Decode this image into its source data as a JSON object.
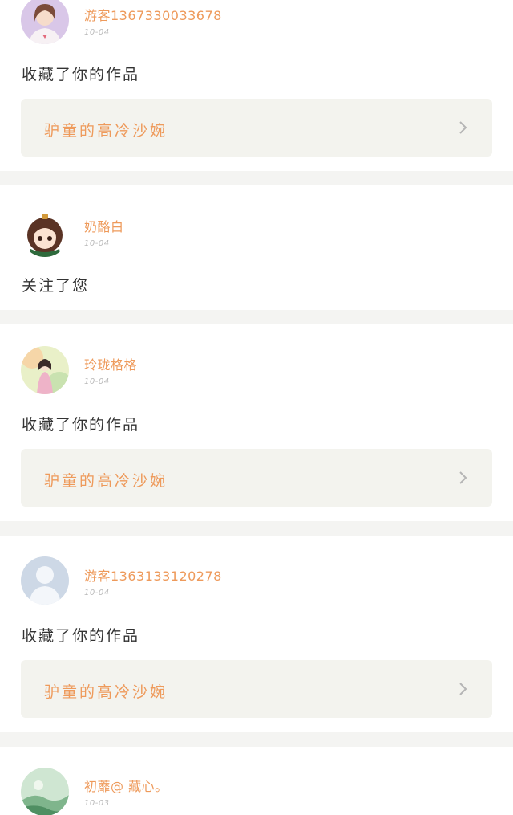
{
  "notifications": [
    {
      "username": "游客1367330033678",
      "time": "10-04",
      "action": "收藏了你的作品",
      "work_title": "驴童的高冷沙婉",
      "avatar_icon": "girl-photo-avatar"
    },
    {
      "username": "奶酪白",
      "time": "10-04",
      "action": "关注了您",
      "avatar_icon": "anime-chibi-avatar"
    },
    {
      "username": "玲珑格格",
      "time": "10-04",
      "action": "收藏了你的作品",
      "work_title": "驴童的高冷沙婉",
      "avatar_icon": "painted-lady-avatar"
    },
    {
      "username": "游客1363133120278",
      "time": "10-04",
      "action": "收藏了你的作品",
      "work_title": "驴童的高冷沙婉",
      "avatar_icon": "default-user-avatar"
    },
    {
      "username": "初蘼@ 藏心。",
      "time": "10-03",
      "avatar_icon": "green-landscape-avatar"
    }
  ],
  "colors": {
    "accent": "#ee9a5b",
    "work_card_bg": "#f3f3ee",
    "separator": "#f4f4f2"
  }
}
